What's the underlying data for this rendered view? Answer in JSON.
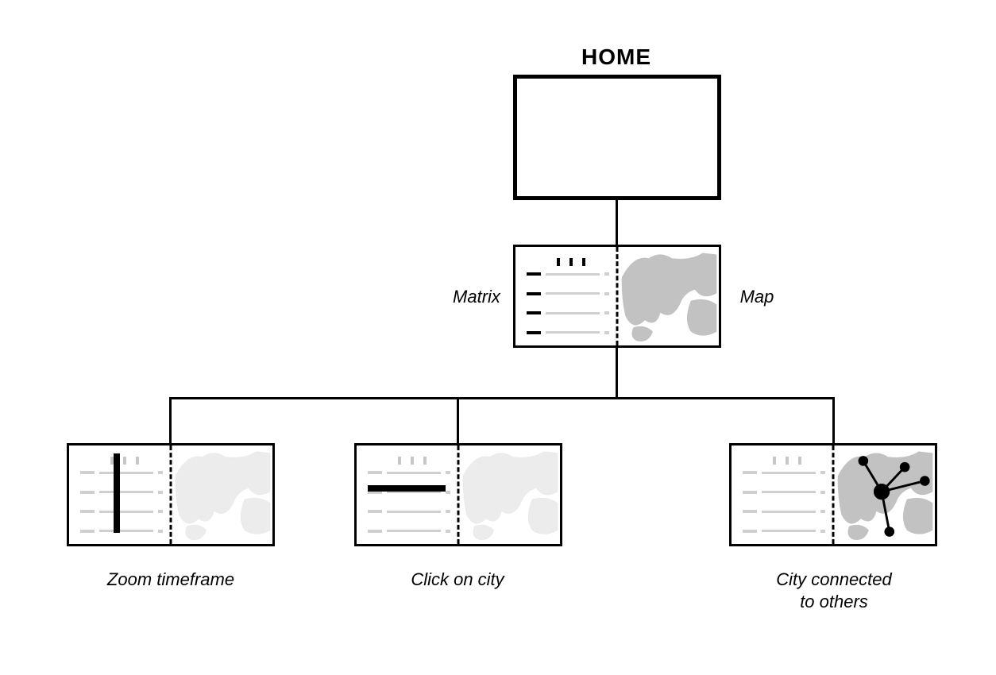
{
  "title": "HOME",
  "labels": {
    "matrix": "Matrix",
    "map": "Map",
    "zoom": "Zoom timeframe",
    "click_city": "Click on city",
    "connected": "City connected\nto others"
  }
}
